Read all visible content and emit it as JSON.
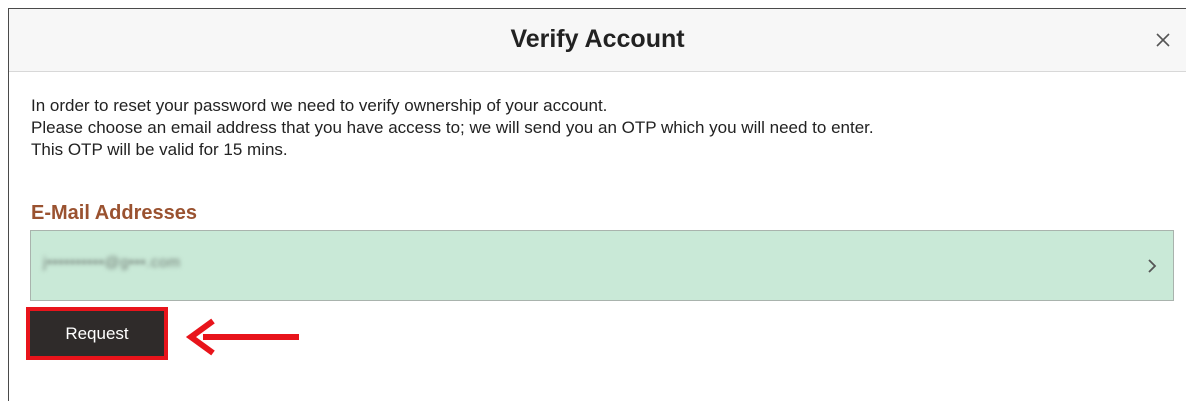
{
  "dialog": {
    "title": "Verify Account",
    "close_icon": "close-icon",
    "instructions": [
      "In order to reset your password we need to verify ownership of your account.",
      "Please choose an email address that you have access to; we will send you an OTP which you will need to enter.",
      "This OTP will be valid for 15 mins."
    ],
    "email_section": {
      "heading": "E-Mail Addresses",
      "items": [
        {
          "address": "j••••••••••@g•••.com",
          "icon": "chevron-right-icon"
        }
      ]
    },
    "request_button": {
      "label": "Request"
    }
  },
  "annotation": {
    "highlight_color": "#e8141b",
    "arrow_icon": "arrow-left-icon"
  },
  "colors": {
    "heading": "#9a5230",
    "row_background": "#c9e9d7",
    "button_background": "#2f2b2a"
  }
}
